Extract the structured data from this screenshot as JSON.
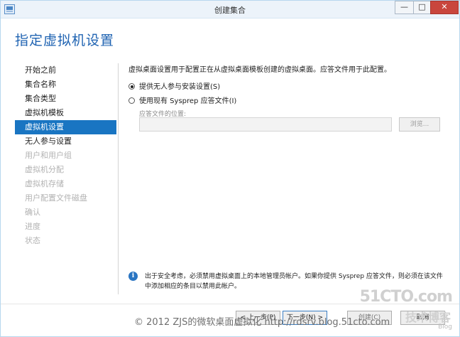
{
  "window": {
    "title": "创建集合",
    "min": "—",
    "max": "□",
    "close": "✕"
  },
  "page_title": "指定虚拟机设置",
  "nav": {
    "items": [
      {
        "label": "开始之前",
        "state": "normal"
      },
      {
        "label": "集合名称",
        "state": "normal"
      },
      {
        "label": "集合类型",
        "state": "normal"
      },
      {
        "label": "虚拟机模板",
        "state": "normal"
      },
      {
        "label": "虚拟机设置",
        "state": "selected"
      },
      {
        "label": "无人参与设置",
        "state": "normal"
      },
      {
        "label": "用户和用户组",
        "state": "disabled"
      },
      {
        "label": "虚拟机分配",
        "state": "disabled"
      },
      {
        "label": "虚拟机存储",
        "state": "disabled"
      },
      {
        "label": "用户配置文件磁盘",
        "state": "disabled"
      },
      {
        "label": "确认",
        "state": "disabled"
      },
      {
        "label": "进度",
        "state": "disabled"
      },
      {
        "label": "状态",
        "state": "disabled"
      }
    ]
  },
  "content": {
    "description": "虚拟桌面设置用于配置正在从虚拟桌面模板创建的虚拟桌面。应答文件用于此配置。",
    "option_unattended": "提供无人参与安装设置(S)",
    "option_sysprep": "使用现有 Sysprep 应答文件(I)",
    "selected_option": "unattended",
    "answer_file_label": "应答文件的位置:",
    "answer_file_value": "",
    "browse_label": "浏览..."
  },
  "info": {
    "icon": "i",
    "text": "出于安全考虑，必须禁用虚拟桌面上的本地管理员帐户。如果你提供 Sysprep 应答文件，则必须在该文件中添加相应的条目以禁用此帐户。"
  },
  "footer": {
    "prev": "< 上一步(P)",
    "next": "下一步(N) >",
    "create": "创建(C)",
    "cancel": "取消"
  },
  "watermark": {
    "text": "© 2012 ZJS的微软桌面虚拟化 http://rdsrv.blog.51cto.com",
    "logo_big": "51CTO.com",
    "logo_sub": "技术博客",
    "logo_blog": "Blog"
  },
  "colors": {
    "accent": "#1975c2",
    "title_blue": "#1f63b2",
    "close_red": "#c9463d"
  }
}
